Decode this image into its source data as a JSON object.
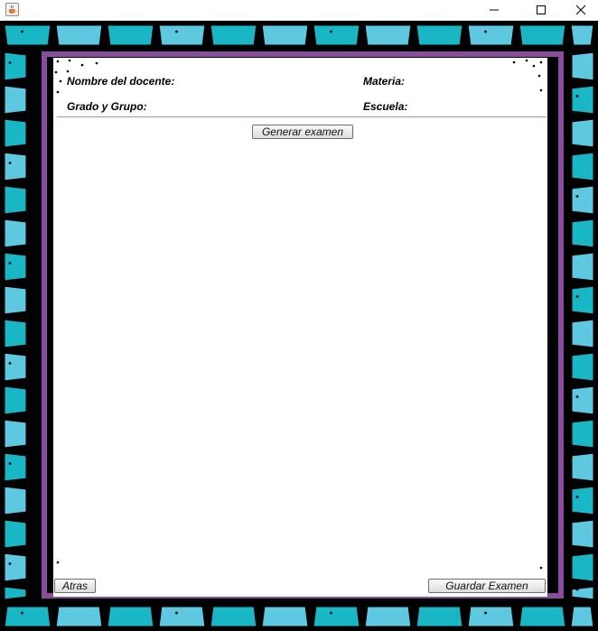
{
  "window": {
    "icon": "java-cup-icon",
    "controls": [
      "minimize-icon",
      "maximize-icon",
      "close-icon"
    ]
  },
  "header": {
    "teacher_label": "Nombre del docente:",
    "subject_label": "Materia:",
    "grade_group_label": "Grado y Grupo:",
    "school_label": "Escuela:"
  },
  "actions": {
    "generate_label": "Generar examen",
    "back_label": "Atras",
    "save_label": "Guardar Examen"
  },
  "colors": {
    "frame_teal": "#19b7c6",
    "frame_light": "#5dc8e0",
    "frame_purple": "#8a4c9c",
    "frame_black": "#000000"
  }
}
